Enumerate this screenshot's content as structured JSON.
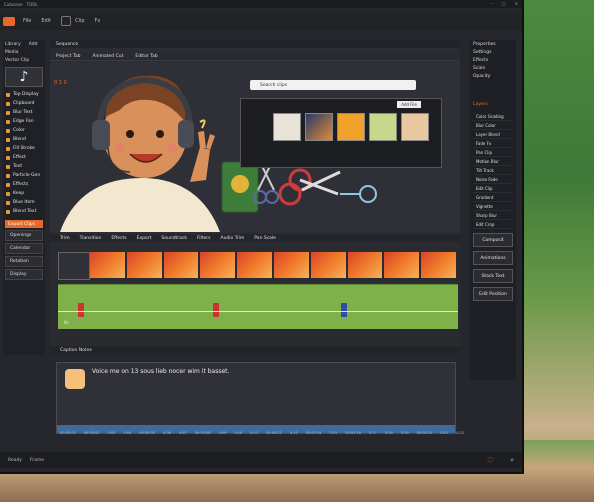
{
  "window": {
    "title": "Cutscene",
    "title_menu": "TOOL",
    "menu_items": [
      "File",
      "Edit",
      "Clip",
      "Fx"
    ]
  },
  "toolbar": {
    "labels": [
      "Clip",
      "Title"
    ]
  },
  "left_panel": {
    "header_items": [
      "Library",
      "Add"
    ],
    "subheader": "Media",
    "section": "Vector Clip",
    "list": [
      "Top Display",
      "Clipboard",
      "Blur Text",
      "Edge Fan",
      "Color",
      "Blend",
      "Fill Stroke",
      "Effect",
      "Text",
      "Particle Gen",
      "Effects",
      "Keep",
      "Blue Item",
      "Blend Text"
    ],
    "orange_label": "Export Clips",
    "buttons": [
      "Openings",
      "Calendar",
      "Rotation",
      "Display"
    ]
  },
  "center": {
    "tabs": [
      "Sequence"
    ],
    "subtabs": [
      "Project Tab",
      "Animated Cut",
      "Editor Tab"
    ],
    "search_placeholder": "Search clips",
    "media_panel_btn": "Add File",
    "frame_label": "0 1 0"
  },
  "right_panel": {
    "header": "Properties",
    "sub_items": [
      "Settings",
      "Effects",
      "Scale",
      "Opacity"
    ],
    "list_header": "Layers",
    "list": [
      "Color Grading",
      "Blur Color",
      "Layer Blend",
      "Fade Fx",
      "Pan Clip",
      "Motion Blur",
      "Tilt Track",
      "Noise Fade",
      "Edit Clip",
      "Gradient",
      "Vignette",
      "Sharp Blur",
      "Edit Crop"
    ],
    "buttons": [
      "Composit",
      "Animations",
      "Stack Text",
      "Edit Position"
    ]
  },
  "timeline": {
    "tracks": [
      "Trim",
      "Transition",
      "Effects",
      "Export",
      "Soundtrack",
      "Filters",
      "Audio Trim",
      "Pan Scale"
    ],
    "marker": "0s"
  },
  "bottom_panel": {
    "header": "Caption Notes",
    "caption": "Voice me on 13 sous lieb nocer wim it basset.",
    "ticks": [
      "00:00:01",
      "00:00:02",
      "0:03",
      "0:04",
      "00:00:05",
      "0:06",
      "0:07",
      "00:00:08",
      "0:09",
      "0:10",
      "0:11",
      "00:00:12",
      "0:13",
      "00:00:14",
      "0:15",
      "00:00:16",
      "0:17",
      "0:18",
      "0:19",
      "00:00:20",
      "0:21",
      "0:22"
    ]
  },
  "status_bar": {
    "items": [
      "Ready",
      "Frame"
    ]
  },
  "colors": {
    "accent": "#e9672b",
    "window_bg": "#26272c",
    "timeline_green": "#7fb04a"
  }
}
